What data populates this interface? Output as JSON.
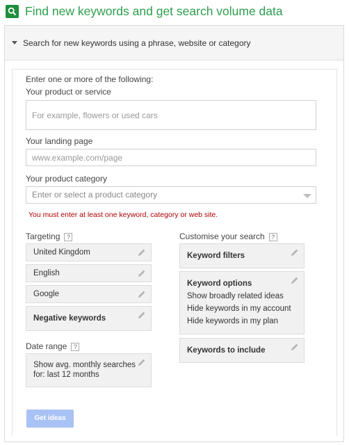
{
  "header": {
    "title": "Find new keywords and get search volume data"
  },
  "search_section": {
    "label": "Search for new keywords using a phrase, website or category"
  },
  "form": {
    "intro": "Enter one or more of the following:",
    "product_label": "Your product or service",
    "product_placeholder": "For example, flowers or used cars",
    "landing_label": "Your landing page",
    "landing_placeholder": "www.example.com/page",
    "category_label": "Your product category",
    "category_placeholder": "Enter or select a product category",
    "error": "You must enter at least one keyword, category or web site."
  },
  "targeting": {
    "label": "Targeting",
    "help": "?",
    "location": "United Kingdom",
    "language": "English",
    "network": "Google",
    "negative": "Negative keywords"
  },
  "date_range": {
    "label": "Date range",
    "help": "?",
    "line1": "Show avg. monthly searches",
    "line2": "for: last 12 months"
  },
  "customise": {
    "label": "Customise your search",
    "help": "?",
    "filters": "Keyword filters",
    "options_title": "Keyword options",
    "options": [
      "Show broadly related ideas",
      "Hide keywords in my account",
      "Hide keywords in my plan"
    ],
    "include": "Keywords to include"
  },
  "actions": {
    "get_ideas": "Get ideas"
  },
  "colors": {
    "accent_green": "#2e9e4d",
    "button_disabled": "#a9c2f5",
    "error_red": "#b00000"
  }
}
